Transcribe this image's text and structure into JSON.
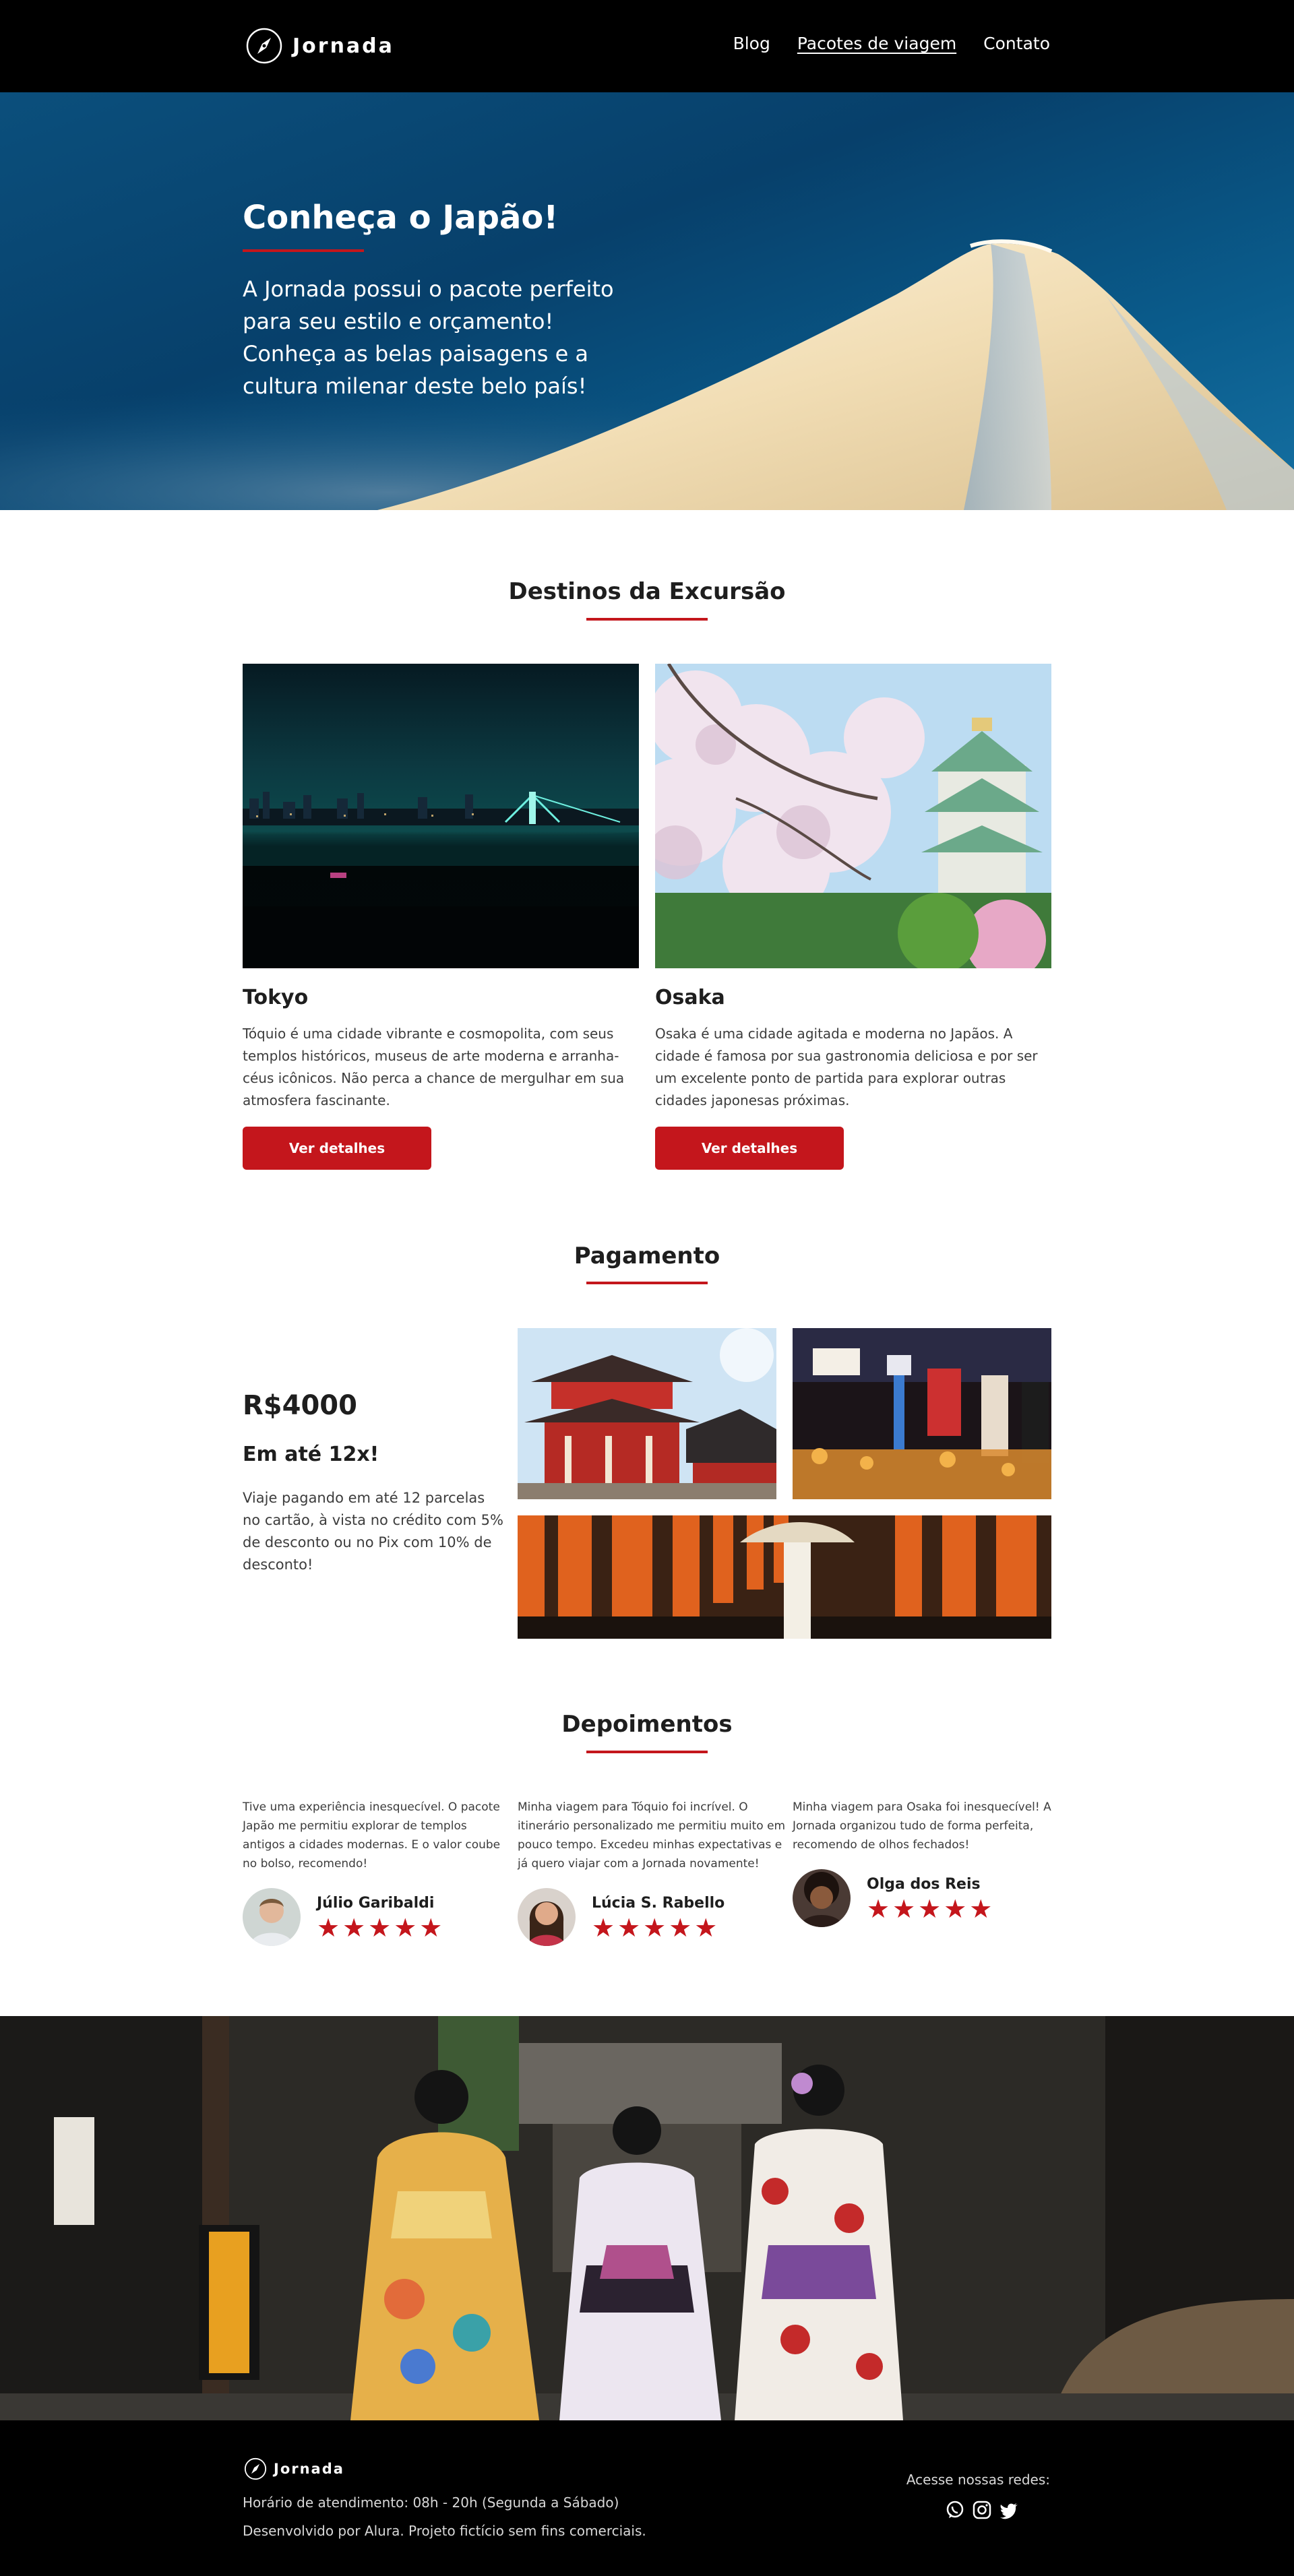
{
  "header": {
    "logo_text": "Jornada",
    "nav": [
      "Blog",
      "Pacotes de viagem",
      "Contato"
    ]
  },
  "hero": {
    "title": "Conheça o Japão!",
    "text": "A Jornada possui o pacote perfeito para seu estilo e orçamento! Conheça as belas paisagens e a cultura milenar deste belo país!"
  },
  "destinations": {
    "title": "Destinos da Excursão",
    "items": [
      {
        "name": "Tokyo",
        "description": "Tóquio é uma cidade vibrante e cosmopolita, com seus templos históricos, museus de arte moderna e arranha-céus icônicos. Não perca a chance de mergulhar em sua atmosfera fascinante.",
        "button": "Ver detalhes"
      },
      {
        "name": "Osaka",
        "description": "Osaka é uma cidade agitada e moderna no Japãos. A cidade é famosa por sua gastronomia deliciosa e por ser um excelente ponto de partida para explorar outras cidades japonesas próximas.",
        "button": "Ver detalhes"
      }
    ]
  },
  "payment": {
    "title": "Pagamento",
    "price": "R$4000",
    "installments": "Em até 12x!",
    "text": "Viaje pagando em até 12 parcelas no cartão, à vista no crédito com 5% de desconto ou no Pix com 10% de desconto!"
  },
  "testimonials": {
    "title": "Depoimentos",
    "items": [
      {
        "text": "Tive uma experiência inesquecível. O pacote Japão me permitiu explorar  de templos antigos a cidades modernas. E o valor coube no bolso, recomendo!",
        "name": "Júlio Garibaldi",
        "rating": 5
      },
      {
        "text": "Minha viagem para Tóquio foi incrível. O itinerário personalizado me permitiu muito em pouco tempo. Excedeu minhas expectativas e já quero viajar com a Jornada novamente!",
        "name": "Lúcia S. Rabello",
        "rating": 5
      },
      {
        "text": "Minha viagem para Osaka foi inesquecível! A Jornada organizou tudo de forma perfeita, recomendo de olhos fechados!",
        "name": "Olga dos Reis",
        "rating": 5
      }
    ],
    "stars": "★★★★★"
  },
  "footer": {
    "logo_text": "Jornada",
    "hours": "Horário de atendimento: 08h - 20h (Segunda a Sábado)",
    "developed": "Desenvolvido por Alura. Projeto fictício sem fins comerciais.",
    "social_label": "Acesse nossas redes:",
    "social_icons": [
      "whatsapp-icon",
      "instagram-icon",
      "twitter-icon"
    ]
  },
  "colors": {
    "accent": "#c4161c",
    "header_bg": "#000000",
    "text": "#1e1e1e"
  }
}
